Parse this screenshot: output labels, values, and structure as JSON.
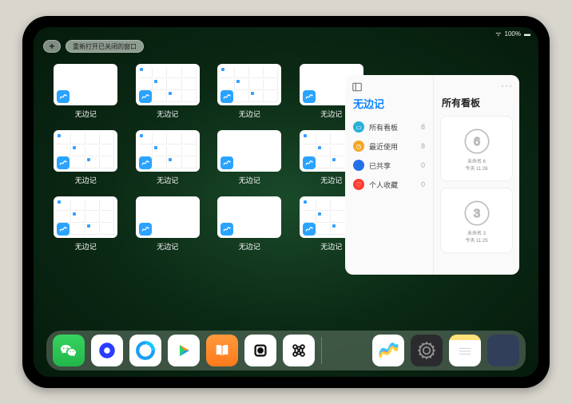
{
  "status": {
    "battery": "100%",
    "signal": "●●●●"
  },
  "top": {
    "plus_label": "+",
    "reopen_label": "重新打开已关闭的窗口"
  },
  "app": {
    "name": "无边记",
    "icon": "freeform-icon"
  },
  "windows": [
    {
      "label": "无边记",
      "variant": "blank"
    },
    {
      "label": "无边记",
      "variant": "calendar"
    },
    {
      "label": "无边记",
      "variant": "calendar"
    },
    {
      "label": "无边记",
      "variant": "blank"
    },
    {
      "label": "无边记",
      "variant": "calendar"
    },
    {
      "label": "无边记",
      "variant": "calendar"
    },
    {
      "label": "无边记",
      "variant": "blank"
    },
    {
      "label": "无边记",
      "variant": "calendar"
    },
    {
      "label": "无边记",
      "variant": "calendar"
    },
    {
      "label": "无边记",
      "variant": "blank"
    },
    {
      "label": "无边记",
      "variant": "blank"
    },
    {
      "label": "无边记",
      "variant": "calendar"
    }
  ],
  "sidebar": {
    "title": "无边记",
    "ellipsis": "···",
    "items": [
      {
        "label": "所有看板",
        "count": "8",
        "color": "#2ab0d9",
        "glyph": "▭"
      },
      {
        "label": "最近使用",
        "count": "8",
        "color": "#f5a623",
        "glyph": "◷"
      },
      {
        "label": "已共享",
        "count": "0",
        "color": "#2a6df4",
        "glyph": "👤"
      },
      {
        "label": "个人收藏",
        "count": "0",
        "color": "#ff3b30",
        "glyph": "♡"
      }
    ]
  },
  "boards": {
    "title": "所有看板",
    "items": [
      {
        "name": "未命名 6",
        "time": "今天 11:26",
        "digit": "6"
      },
      {
        "name": "未命名 3",
        "time": "今天 11:25",
        "digit": "3"
      }
    ]
  },
  "dock": {
    "main": [
      {
        "name": "wechat",
        "title": "WeChat"
      },
      {
        "name": "quark",
        "title": "Quark"
      },
      {
        "name": "qqbrowser",
        "title": "QQ Browser"
      },
      {
        "name": "tencent-video",
        "title": "Tencent Video"
      },
      {
        "name": "books",
        "title": "Books"
      },
      {
        "name": "obsidian",
        "title": "App"
      },
      {
        "name": "nomo",
        "title": "App"
      }
    ],
    "side": [
      {
        "name": "freeform",
        "title": "无边记"
      },
      {
        "name": "settings",
        "title": "设置"
      },
      {
        "name": "notes",
        "title": "备忘录"
      },
      {
        "name": "app-library",
        "title": "App Library"
      }
    ]
  }
}
